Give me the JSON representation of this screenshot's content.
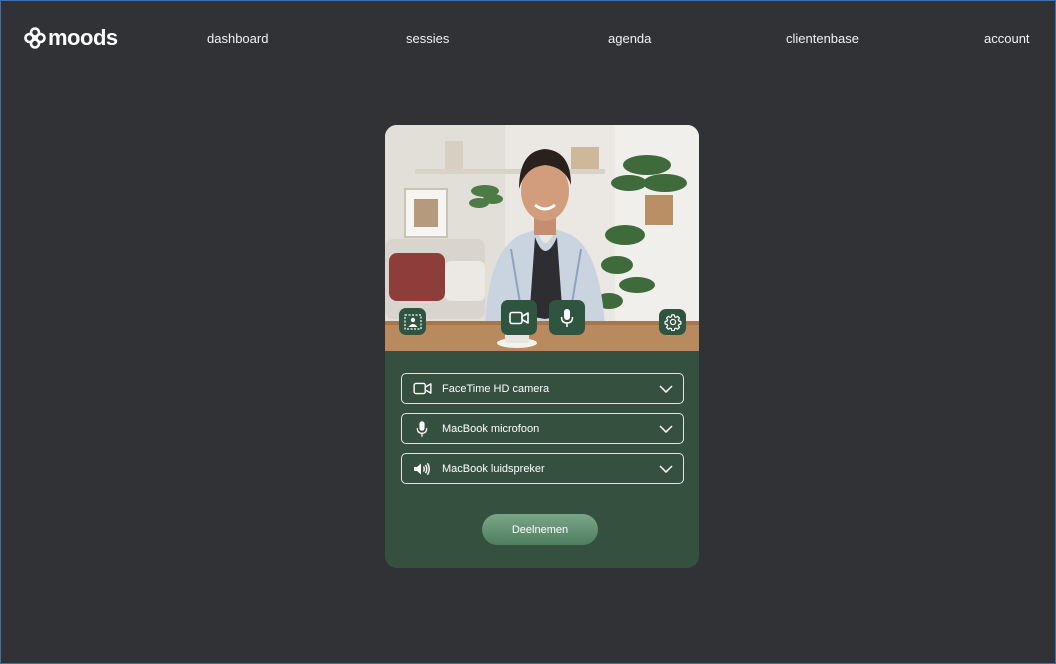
{
  "app": {
    "logo_text": "moods"
  },
  "nav": {
    "items": [
      {
        "label": "dashboard"
      },
      {
        "label": "sessies"
      },
      {
        "label": "agenda"
      },
      {
        "label": "clientenbase"
      },
      {
        "label": "account"
      }
    ]
  },
  "preview": {
    "controls": {
      "background": "background-blur-icon",
      "camera": "video-camera-icon",
      "microphone": "microphone-icon",
      "settings": "gear-icon"
    }
  },
  "devices": {
    "camera": {
      "label": "FaceTime HD camera",
      "icon": "video-camera-icon"
    },
    "microphone": {
      "label": "MacBook microfoon",
      "icon": "microphone-icon"
    },
    "speaker": {
      "label": "MacBook luidspreker",
      "icon": "speaker-icon"
    }
  },
  "join_button": {
    "label": "Deelnemen"
  },
  "colors": {
    "background": "#303236",
    "card": "#365040",
    "accent": "#6a9a7a"
  }
}
